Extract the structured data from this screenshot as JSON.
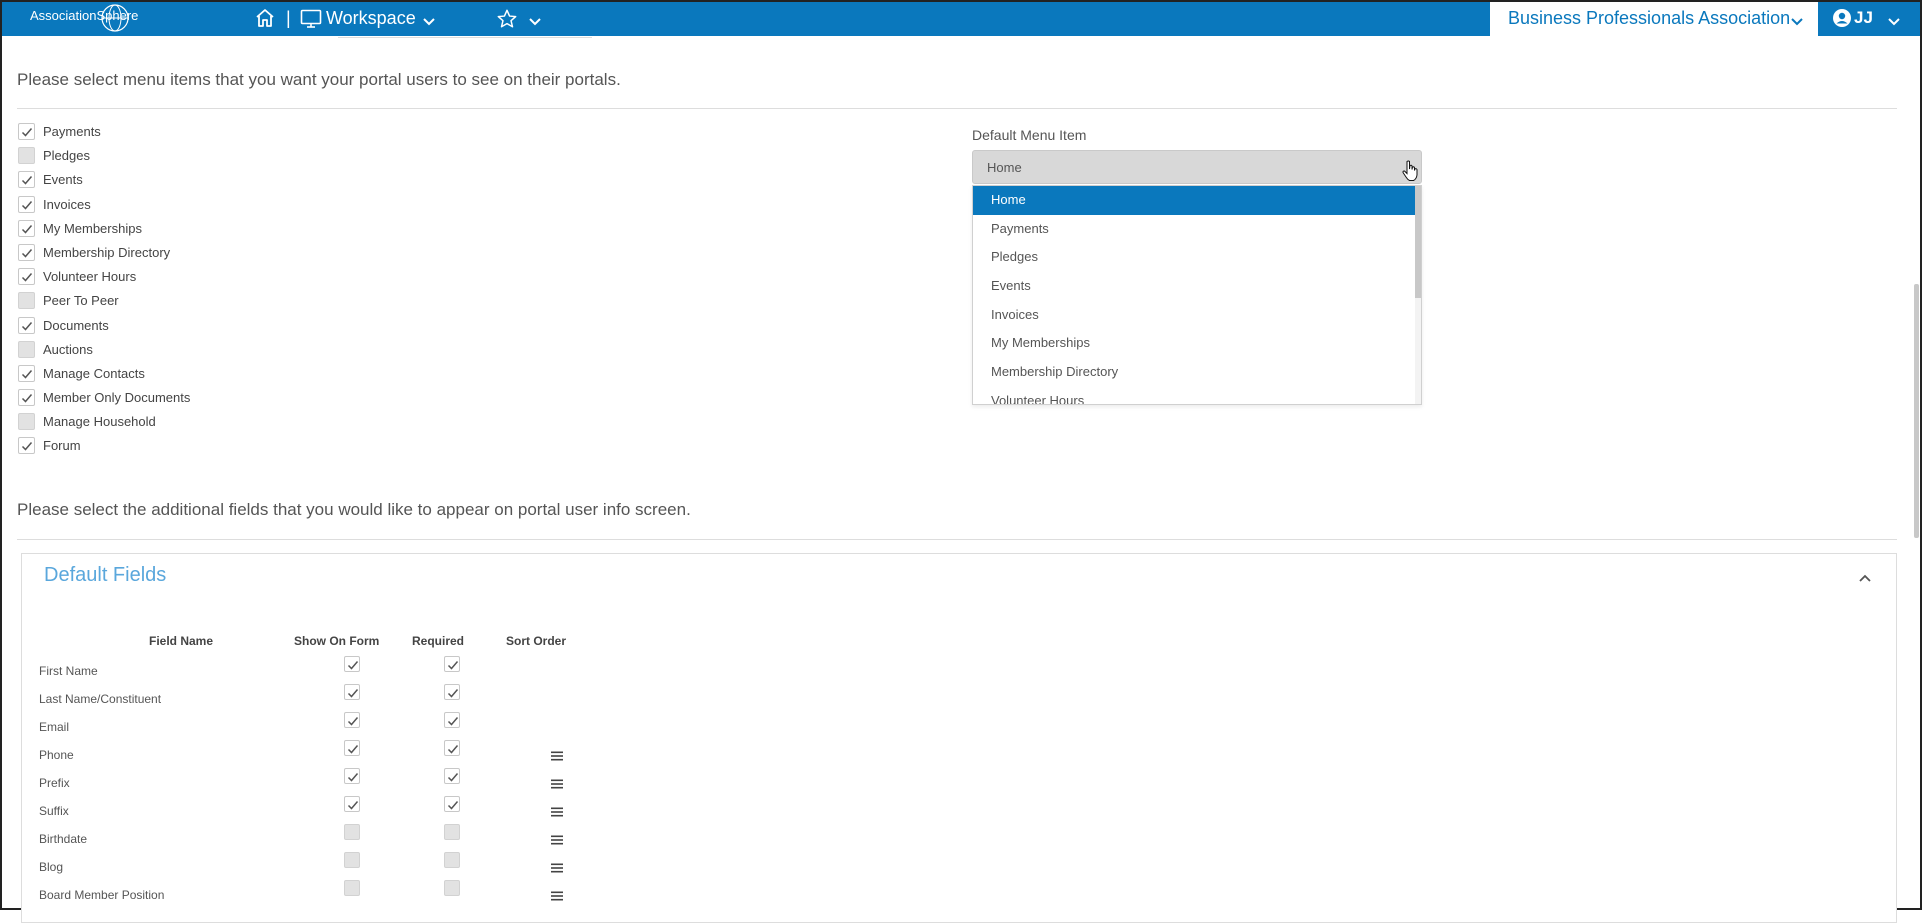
{
  "topbar": {
    "logo_text": "AssociationSphere",
    "workspace_label": "Workspace",
    "org_name": "Business Professionals Association",
    "user_initials": "JJ",
    "colors": {
      "brand": "#0a78bd",
      "light_blue_title": "#5aa7dc"
    }
  },
  "menu_section": {
    "title": "Please select menu items that you want your portal users to see on their portals.",
    "items": [
      {
        "label": "Payments",
        "checked": true
      },
      {
        "label": "Pledges",
        "checked": false
      },
      {
        "label": "Events",
        "checked": true
      },
      {
        "label": "Invoices",
        "checked": true
      },
      {
        "label": "My Memberships",
        "checked": true
      },
      {
        "label": "Membership Directory",
        "checked": true
      },
      {
        "label": "Volunteer Hours",
        "checked": true
      },
      {
        "label": "Peer To Peer",
        "checked": false
      },
      {
        "label": "Documents",
        "checked": true
      },
      {
        "label": "Auctions",
        "checked": false
      },
      {
        "label": "Manage Contacts",
        "checked": true
      },
      {
        "label": "Member Only Documents",
        "checked": true
      },
      {
        "label": "Manage Household",
        "checked": false
      },
      {
        "label": "Forum",
        "checked": true
      }
    ]
  },
  "default_menu": {
    "label": "Default Menu Item",
    "selected": "Home",
    "options": [
      "Home",
      "Payments",
      "Pledges",
      "Events",
      "Invoices",
      "My Memberships",
      "Membership Directory",
      "Volunteer Hours"
    ]
  },
  "fields_section": {
    "title": "Please select the additional fields that you would like to appear on portal user info screen.",
    "panel_title": "Default Fields",
    "headers": {
      "field_name": "Field Name",
      "show_on_form": "Show On Form",
      "required": "Required",
      "sort_order": "Sort Order"
    },
    "rows": [
      {
        "name": "First Name",
        "show": true,
        "required": true,
        "sortable": false
      },
      {
        "name": "Last Name/Constituent",
        "show": true,
        "required": true,
        "sortable": false
      },
      {
        "name": "Email",
        "show": true,
        "required": true,
        "sortable": false
      },
      {
        "name": "Phone",
        "show": true,
        "required": true,
        "sortable": true
      },
      {
        "name": "Prefix",
        "show": true,
        "required": true,
        "sortable": true
      },
      {
        "name": "Suffix",
        "show": true,
        "required": true,
        "sortable": true
      },
      {
        "name": "Birthdate",
        "show": false,
        "required": false,
        "sortable": true
      },
      {
        "name": "Blog",
        "show": false,
        "required": false,
        "sortable": true
      },
      {
        "name": "Board Member Position",
        "show": false,
        "required": false,
        "sortable": true
      }
    ]
  }
}
